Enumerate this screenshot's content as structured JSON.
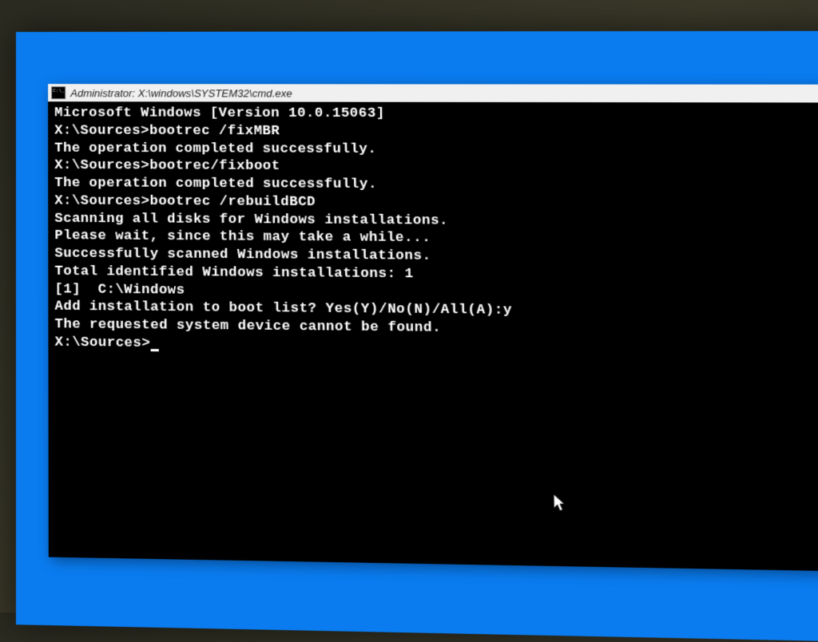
{
  "titlebar": {
    "text": "Administrator: X:\\windows\\SYSTEM32\\cmd.exe"
  },
  "terminal": {
    "lines": [
      "Microsoft Windows [Version 10.0.15063]",
      "",
      "X:\\Sources>bootrec /fixMBR",
      "The operation completed successfully.",
      "",
      "X:\\Sources>bootrec/fixboot",
      "The operation completed successfully.",
      "",
      "X:\\Sources>bootrec /rebuildBCD",
      "Scanning all disks for Windows installations.",
      "",
      "Please wait, since this may take a while...",
      "",
      "Successfully scanned Windows installations.",
      "Total identified Windows installations: 1",
      "[1]  C:\\Windows",
      "Add installation to boot list? Yes(Y)/No(N)/All(A):y",
      "The requested system device cannot be found.",
      "",
      "X:\\Sources>"
    ]
  }
}
